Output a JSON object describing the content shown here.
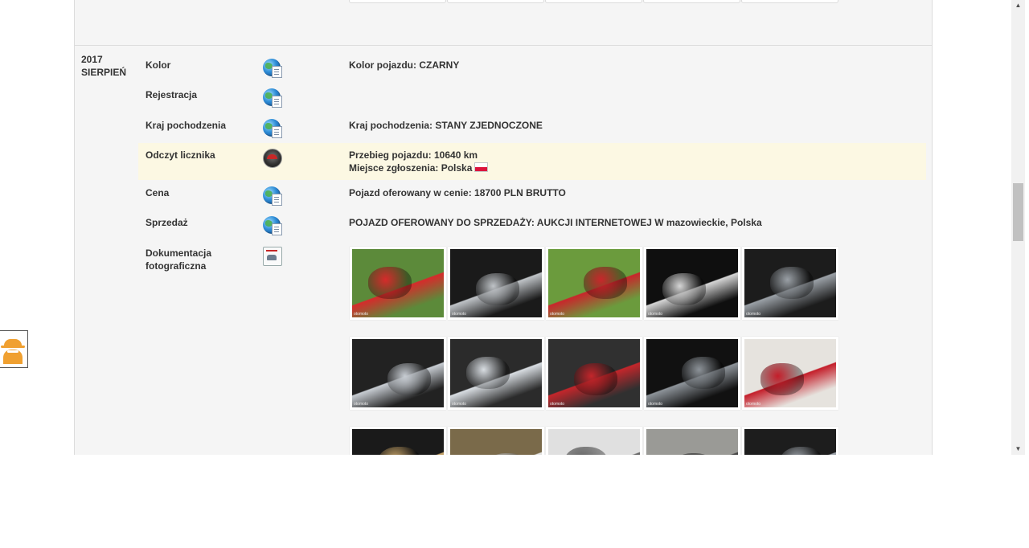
{
  "entry": {
    "year": "2017",
    "month": "SIERPIEŃ"
  },
  "rows": [
    {
      "label": "Kolor",
      "icon": "globe-doc-icon",
      "value": "Kolor pojazdu: CZARNY"
    },
    {
      "label": "Rejestracja",
      "icon": "globe-doc-icon",
      "value": ""
    },
    {
      "label": "Kraj pochodzenia",
      "icon": "globe-doc-icon",
      "value": "Kraj pochodzenia: STANY ZJEDNOCZONE"
    },
    {
      "label": "Odczyt licznika",
      "icon": "speedometer-icon",
      "value": "Przebieg pojazdu: 10640 km",
      "value2": "Miejsce zgłoszenia: Polska",
      "flag": "poland-flag-icon"
    },
    {
      "label": "Cena",
      "icon": "globe-doc-icon",
      "value": "Pojazd oferowany w cenie: 18700 PLN BRUTTO"
    },
    {
      "label": "Sprzedaż",
      "icon": "globe-doc-icon",
      "value": "POJAZD OFEROWANY DO SPRZEDAŻY: AUKCJI INTERNETOWEJ W mazowieckie, Polska"
    },
    {
      "label": "Dokumentacja fotograficzna",
      "label_line1": "Dokumentacja",
      "label_line2": "fotograficzna",
      "icon": "photo-document-icon"
    }
  ],
  "gallery": {
    "watermark": "otomoto",
    "photos": [
      {
        "desc": "motorcycle-side-grass",
        "bg": "#5c8a3a",
        "accent": "#d62b2b"
      },
      {
        "desc": "motorcycle-engine-black",
        "bg": "#1a1a1a",
        "accent": "#bfc3c7"
      },
      {
        "desc": "motorcycle-red-truck",
        "bg": "#6b9b3d",
        "accent": "#c9262b"
      },
      {
        "desc": "speedometer-closeup",
        "bg": "#0f0f0f",
        "accent": "#d5d5d5"
      },
      {
        "desc": "rear-wheel-closeup",
        "bg": "#1c1c1c",
        "accent": "#9aa0a6"
      },
      {
        "desc": "chrome-engine-1",
        "bg": "#222222",
        "accent": "#c7ccd2"
      },
      {
        "desc": "chrome-engine-2",
        "bg": "#2b2b2b",
        "accent": "#d8dde2"
      },
      {
        "desc": "chrome-engine-red",
        "bg": "#303030",
        "accent": "#c3262b"
      },
      {
        "desc": "rear-wheel-2",
        "bg": "#111111",
        "accent": "#8d9399"
      },
      {
        "desc": "saddlebag-red",
        "bg": "#e6e3de",
        "accent": "#c41e2a"
      },
      {
        "desc": "front-wheel",
        "bg": "#1a1a1a",
        "accent": "#c9a66b"
      },
      {
        "desc": "headlight",
        "bg": "#7a6a4a",
        "accent": "#e8e8e8"
      },
      {
        "desc": "wheel-chrome",
        "bg": "#e0e0e0",
        "accent": "#666666"
      },
      {
        "desc": "garage-bikes",
        "bg": "#9a9a96",
        "accent": "#444444"
      },
      {
        "desc": "rear-fender",
        "bg": "#1d1d1d",
        "accent": "#a0a6ad"
      }
    ]
  },
  "floating_button": {
    "icon": "incognito-spy-icon"
  }
}
